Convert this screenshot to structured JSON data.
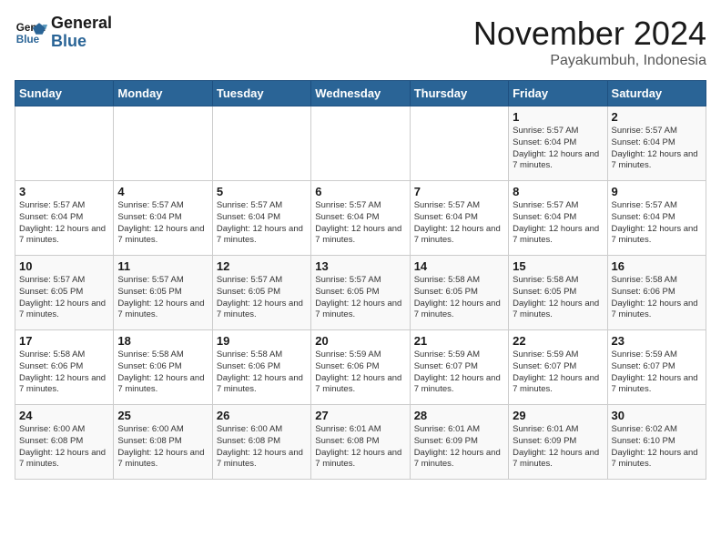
{
  "header": {
    "logo_line1": "General",
    "logo_line2": "Blue",
    "title": "November 2024",
    "subtitle": "Payakumbuh, Indonesia"
  },
  "days_of_week": [
    "Sunday",
    "Monday",
    "Tuesday",
    "Wednesday",
    "Thursday",
    "Friday",
    "Saturday"
  ],
  "weeks": [
    [
      {
        "day": "",
        "info": ""
      },
      {
        "day": "",
        "info": ""
      },
      {
        "day": "",
        "info": ""
      },
      {
        "day": "",
        "info": ""
      },
      {
        "day": "",
        "info": ""
      },
      {
        "day": "1",
        "info": "Sunrise: 5:57 AM\nSunset: 6:04 PM\nDaylight: 12 hours and 7 minutes."
      },
      {
        "day": "2",
        "info": "Sunrise: 5:57 AM\nSunset: 6:04 PM\nDaylight: 12 hours and 7 minutes."
      }
    ],
    [
      {
        "day": "3",
        "info": "Sunrise: 5:57 AM\nSunset: 6:04 PM\nDaylight: 12 hours and 7 minutes."
      },
      {
        "day": "4",
        "info": "Sunrise: 5:57 AM\nSunset: 6:04 PM\nDaylight: 12 hours and 7 minutes."
      },
      {
        "day": "5",
        "info": "Sunrise: 5:57 AM\nSunset: 6:04 PM\nDaylight: 12 hours and 7 minutes."
      },
      {
        "day": "6",
        "info": "Sunrise: 5:57 AM\nSunset: 6:04 PM\nDaylight: 12 hours and 7 minutes."
      },
      {
        "day": "7",
        "info": "Sunrise: 5:57 AM\nSunset: 6:04 PM\nDaylight: 12 hours and 7 minutes."
      },
      {
        "day": "8",
        "info": "Sunrise: 5:57 AM\nSunset: 6:04 PM\nDaylight: 12 hours and 7 minutes."
      },
      {
        "day": "9",
        "info": "Sunrise: 5:57 AM\nSunset: 6:04 PM\nDaylight: 12 hours and 7 minutes."
      }
    ],
    [
      {
        "day": "10",
        "info": "Sunrise: 5:57 AM\nSunset: 6:05 PM\nDaylight: 12 hours and 7 minutes."
      },
      {
        "day": "11",
        "info": "Sunrise: 5:57 AM\nSunset: 6:05 PM\nDaylight: 12 hours and 7 minutes."
      },
      {
        "day": "12",
        "info": "Sunrise: 5:57 AM\nSunset: 6:05 PM\nDaylight: 12 hours and 7 minutes."
      },
      {
        "day": "13",
        "info": "Sunrise: 5:57 AM\nSunset: 6:05 PM\nDaylight: 12 hours and 7 minutes."
      },
      {
        "day": "14",
        "info": "Sunrise: 5:58 AM\nSunset: 6:05 PM\nDaylight: 12 hours and 7 minutes."
      },
      {
        "day": "15",
        "info": "Sunrise: 5:58 AM\nSunset: 6:05 PM\nDaylight: 12 hours and 7 minutes."
      },
      {
        "day": "16",
        "info": "Sunrise: 5:58 AM\nSunset: 6:06 PM\nDaylight: 12 hours and 7 minutes."
      }
    ],
    [
      {
        "day": "17",
        "info": "Sunrise: 5:58 AM\nSunset: 6:06 PM\nDaylight: 12 hours and 7 minutes."
      },
      {
        "day": "18",
        "info": "Sunrise: 5:58 AM\nSunset: 6:06 PM\nDaylight: 12 hours and 7 minutes."
      },
      {
        "day": "19",
        "info": "Sunrise: 5:58 AM\nSunset: 6:06 PM\nDaylight: 12 hours and 7 minutes."
      },
      {
        "day": "20",
        "info": "Sunrise: 5:59 AM\nSunset: 6:06 PM\nDaylight: 12 hours and 7 minutes."
      },
      {
        "day": "21",
        "info": "Sunrise: 5:59 AM\nSunset: 6:07 PM\nDaylight: 12 hours and 7 minutes."
      },
      {
        "day": "22",
        "info": "Sunrise: 5:59 AM\nSunset: 6:07 PM\nDaylight: 12 hours and 7 minutes."
      },
      {
        "day": "23",
        "info": "Sunrise: 5:59 AM\nSunset: 6:07 PM\nDaylight: 12 hours and 7 minutes."
      }
    ],
    [
      {
        "day": "24",
        "info": "Sunrise: 6:00 AM\nSunset: 6:08 PM\nDaylight: 12 hours and 7 minutes."
      },
      {
        "day": "25",
        "info": "Sunrise: 6:00 AM\nSunset: 6:08 PM\nDaylight: 12 hours and 7 minutes."
      },
      {
        "day": "26",
        "info": "Sunrise: 6:00 AM\nSunset: 6:08 PM\nDaylight: 12 hours and 7 minutes."
      },
      {
        "day": "27",
        "info": "Sunrise: 6:01 AM\nSunset: 6:08 PM\nDaylight: 12 hours and 7 minutes."
      },
      {
        "day": "28",
        "info": "Sunrise: 6:01 AM\nSunset: 6:09 PM\nDaylight: 12 hours and 7 minutes."
      },
      {
        "day": "29",
        "info": "Sunrise: 6:01 AM\nSunset: 6:09 PM\nDaylight: 12 hours and 7 minutes."
      },
      {
        "day": "30",
        "info": "Sunrise: 6:02 AM\nSunset: 6:10 PM\nDaylight: 12 hours and 7 minutes."
      }
    ]
  ]
}
